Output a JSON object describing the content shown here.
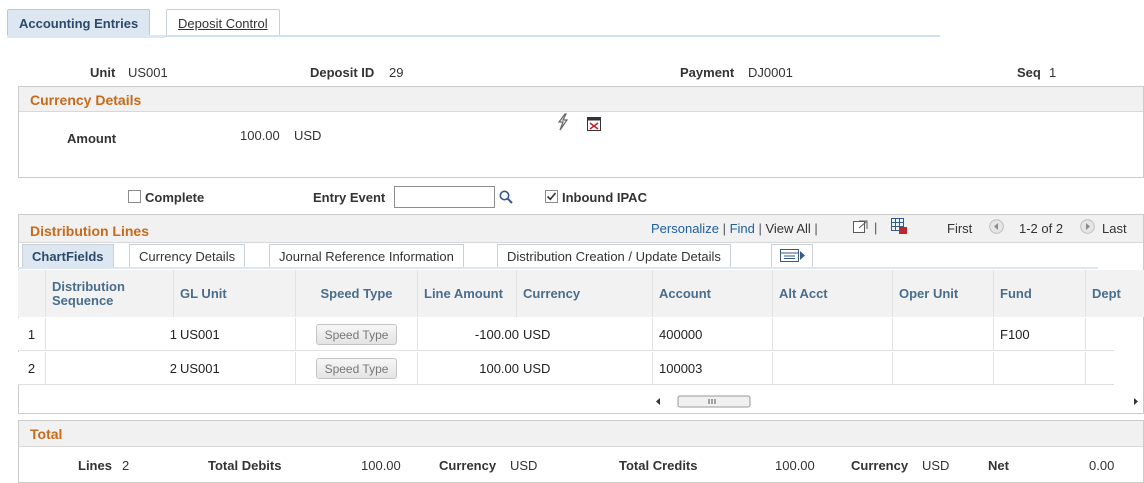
{
  "tabs": {
    "accounting": "Accounting Entries",
    "deposit": "Deposit Control"
  },
  "header": {
    "unit_label": "Unit",
    "unit_value": "US001",
    "deposit_label": "Deposit ID",
    "deposit_value": "29",
    "payment_label": "Payment",
    "payment_value": "DJ0001",
    "seq_label": "Seq",
    "seq_value": "1"
  },
  "currency_details": {
    "title": "Currency Details",
    "amount_label": "Amount",
    "amount_value": "100.00",
    "amount_currency": "USD"
  },
  "options": {
    "complete_label": "Complete",
    "complete_checked": false,
    "entry_event_label": "Entry Event",
    "entry_event_value": "",
    "inbound_ipac_label": "Inbound IPAC",
    "inbound_ipac_checked": true
  },
  "distribution": {
    "title": "Distribution Lines",
    "personalize": "Personalize",
    "find": "Find",
    "view_all": "View All",
    "first": "First",
    "range": "1-2 of 2",
    "last": "Last",
    "tabs": [
      "ChartFields",
      "Currency Details",
      "Journal Reference Information",
      "Distribution Creation / Update Details"
    ],
    "columns": [
      "Distribution Sequence",
      "GL Unit",
      "Speed Type",
      "Line Amount",
      "Currency",
      "Account",
      "Alt Acct",
      "Oper Unit",
      "Fund",
      "Dept"
    ],
    "speed_type_button": "Speed Type",
    "rows": [
      {
        "num": "1",
        "seq": "1",
        "gl_unit": "US001",
        "line_amount": "-100.00",
        "currency": "USD",
        "account": "400000",
        "alt_acct": "",
        "oper_unit": "",
        "fund": "F100",
        "dept": ""
      },
      {
        "num": "2",
        "seq": "2",
        "gl_unit": "US001",
        "line_amount": "100.00",
        "currency": "USD",
        "account": "100003",
        "alt_acct": "",
        "oper_unit": "",
        "fund": "",
        "dept": ""
      }
    ]
  },
  "total": {
    "title": "Total",
    "lines_label": "Lines",
    "lines_value": "2",
    "debits_label": "Total Debits",
    "debits_value": "100.00",
    "currency1_label": "Currency",
    "currency1_value": "USD",
    "credits_label": "Total Credits",
    "credits_value": "100.00",
    "currency2_label": "Currency",
    "currency2_value": "USD",
    "net_label": "Net",
    "net_value": "0.00"
  },
  "colors": {
    "section_title": "#c76a1a",
    "link": "#1f5fa3",
    "tab_active_bg": "#dde7f1"
  }
}
